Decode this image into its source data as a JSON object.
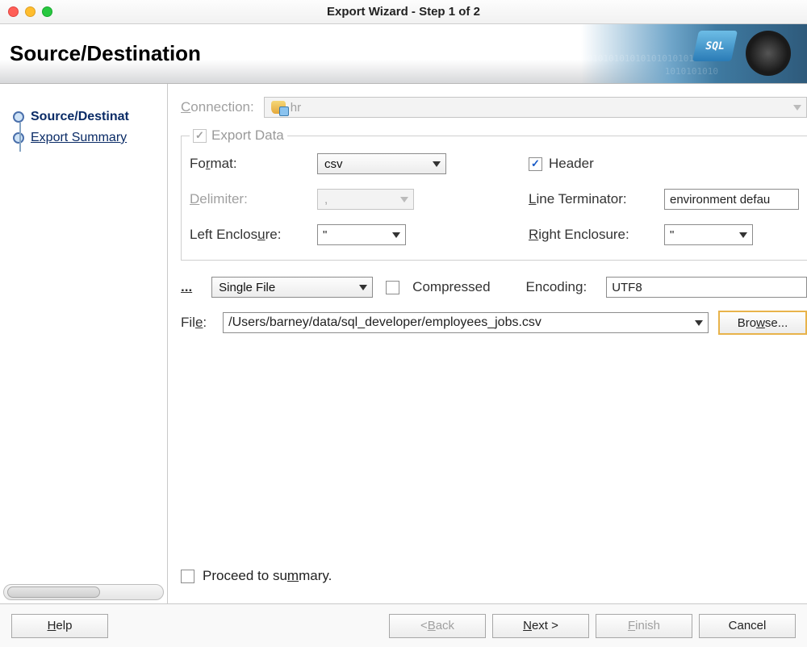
{
  "window": {
    "title": "Export Wizard - Step 1 of 2"
  },
  "banner": {
    "title": "Source/Destination"
  },
  "sidebar": {
    "step1": "Source/Destinat",
    "step2": "Export Summary"
  },
  "form": {
    "connection_label": "Connection:",
    "connection_value": "hr",
    "export_data_label": "Export Data",
    "export_data_checked": "✓",
    "format_label": "Format:",
    "format_value": "csv",
    "header_label": "Header",
    "header_checked": "✓",
    "delimiter_label": "Delimiter:",
    "delimiter_value": ",",
    "line_term_label": "Line Terminator:",
    "line_term_value": "environment defau",
    "left_enc_label": "Left Enclosure:",
    "left_enc_value": "\"",
    "right_enc_label": "Right Enclosure:",
    "right_enc_value": "\"",
    "ellipsis_label": "...",
    "file_mode": "Single File",
    "compressed_label": "Compressed",
    "encoding_label": "Encoding:",
    "encoding_value": "UTF8",
    "file_label": "File:",
    "file_value": "/Users/barney/data/sql_developer/employees_jobs.csv",
    "browse_label": "Browse...",
    "proceed_label": "Proceed to summary."
  },
  "footer": {
    "help": "Help",
    "back": "< Back",
    "next": "Next >",
    "finish": "Finish",
    "cancel": "Cancel"
  }
}
